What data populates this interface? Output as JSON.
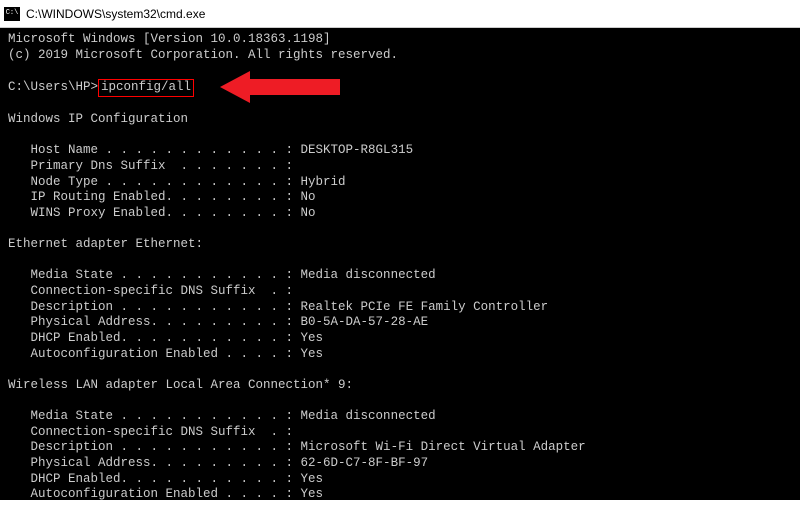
{
  "titlebar": {
    "text": "C:\\WINDOWS\\system32\\cmd.exe"
  },
  "header": {
    "version_line": "Microsoft Windows [Version 10.0.18363.1198]",
    "copyright_line": "(c) 2019 Microsoft Corporation. All rights reserved."
  },
  "prompt": {
    "path": "C:\\Users\\HP>",
    "command": "ipconfig/all"
  },
  "sections": {
    "ipconfig_header": "Windows IP Configuration",
    "ipconfig": [
      {
        "label": "   Host Name . . . . . . . . . . . . :",
        "value": " DESKTOP-R8GL315"
      },
      {
        "label": "   Primary Dns Suffix  . . . . . . . :",
        "value": ""
      },
      {
        "label": "   Node Type . . . . . . . . . . . . :",
        "value": " Hybrid"
      },
      {
        "label": "   IP Routing Enabled. . . . . . . . :",
        "value": " No"
      },
      {
        "label": "   WINS Proxy Enabled. . . . . . . . :",
        "value": " No"
      }
    ],
    "eth_header": "Ethernet adapter Ethernet:",
    "eth": [
      {
        "label": "   Media State . . . . . . . . . . . :",
        "value": " Media disconnected"
      },
      {
        "label": "   Connection-specific DNS Suffix  . :",
        "value": ""
      },
      {
        "label": "   Description . . . . . . . . . . . :",
        "value": " Realtek PCIe FE Family Controller"
      },
      {
        "label": "   Physical Address. . . . . . . . . :",
        "value": " B0-5A-DA-57-28-AE"
      },
      {
        "label": "   DHCP Enabled. . . . . . . . . . . :",
        "value": " Yes"
      },
      {
        "label": "   Autoconfiguration Enabled . . . . :",
        "value": " Yes"
      }
    ],
    "wlan_header": "Wireless LAN adapter Local Area Connection* 9:",
    "wlan": [
      {
        "label": "   Media State . . . . . . . . . . . :",
        "value": " Media disconnected"
      },
      {
        "label": "   Connection-specific DNS Suffix  . :",
        "value": ""
      },
      {
        "label": "   Description . . . . . . . . . . . :",
        "value": " Microsoft Wi-Fi Direct Virtual Adapter"
      },
      {
        "label": "   Physical Address. . . . . . . . . :",
        "value": " 62-6D-C7-8F-BF-97"
      },
      {
        "label": "   DHCP Enabled. . . . . . . . . . . :",
        "value": " Yes"
      },
      {
        "label": "   Autoconfiguration Enabled . . . . :",
        "value": " Yes"
      }
    ]
  },
  "annotation": {
    "arrow_color": "#ee1c25"
  }
}
